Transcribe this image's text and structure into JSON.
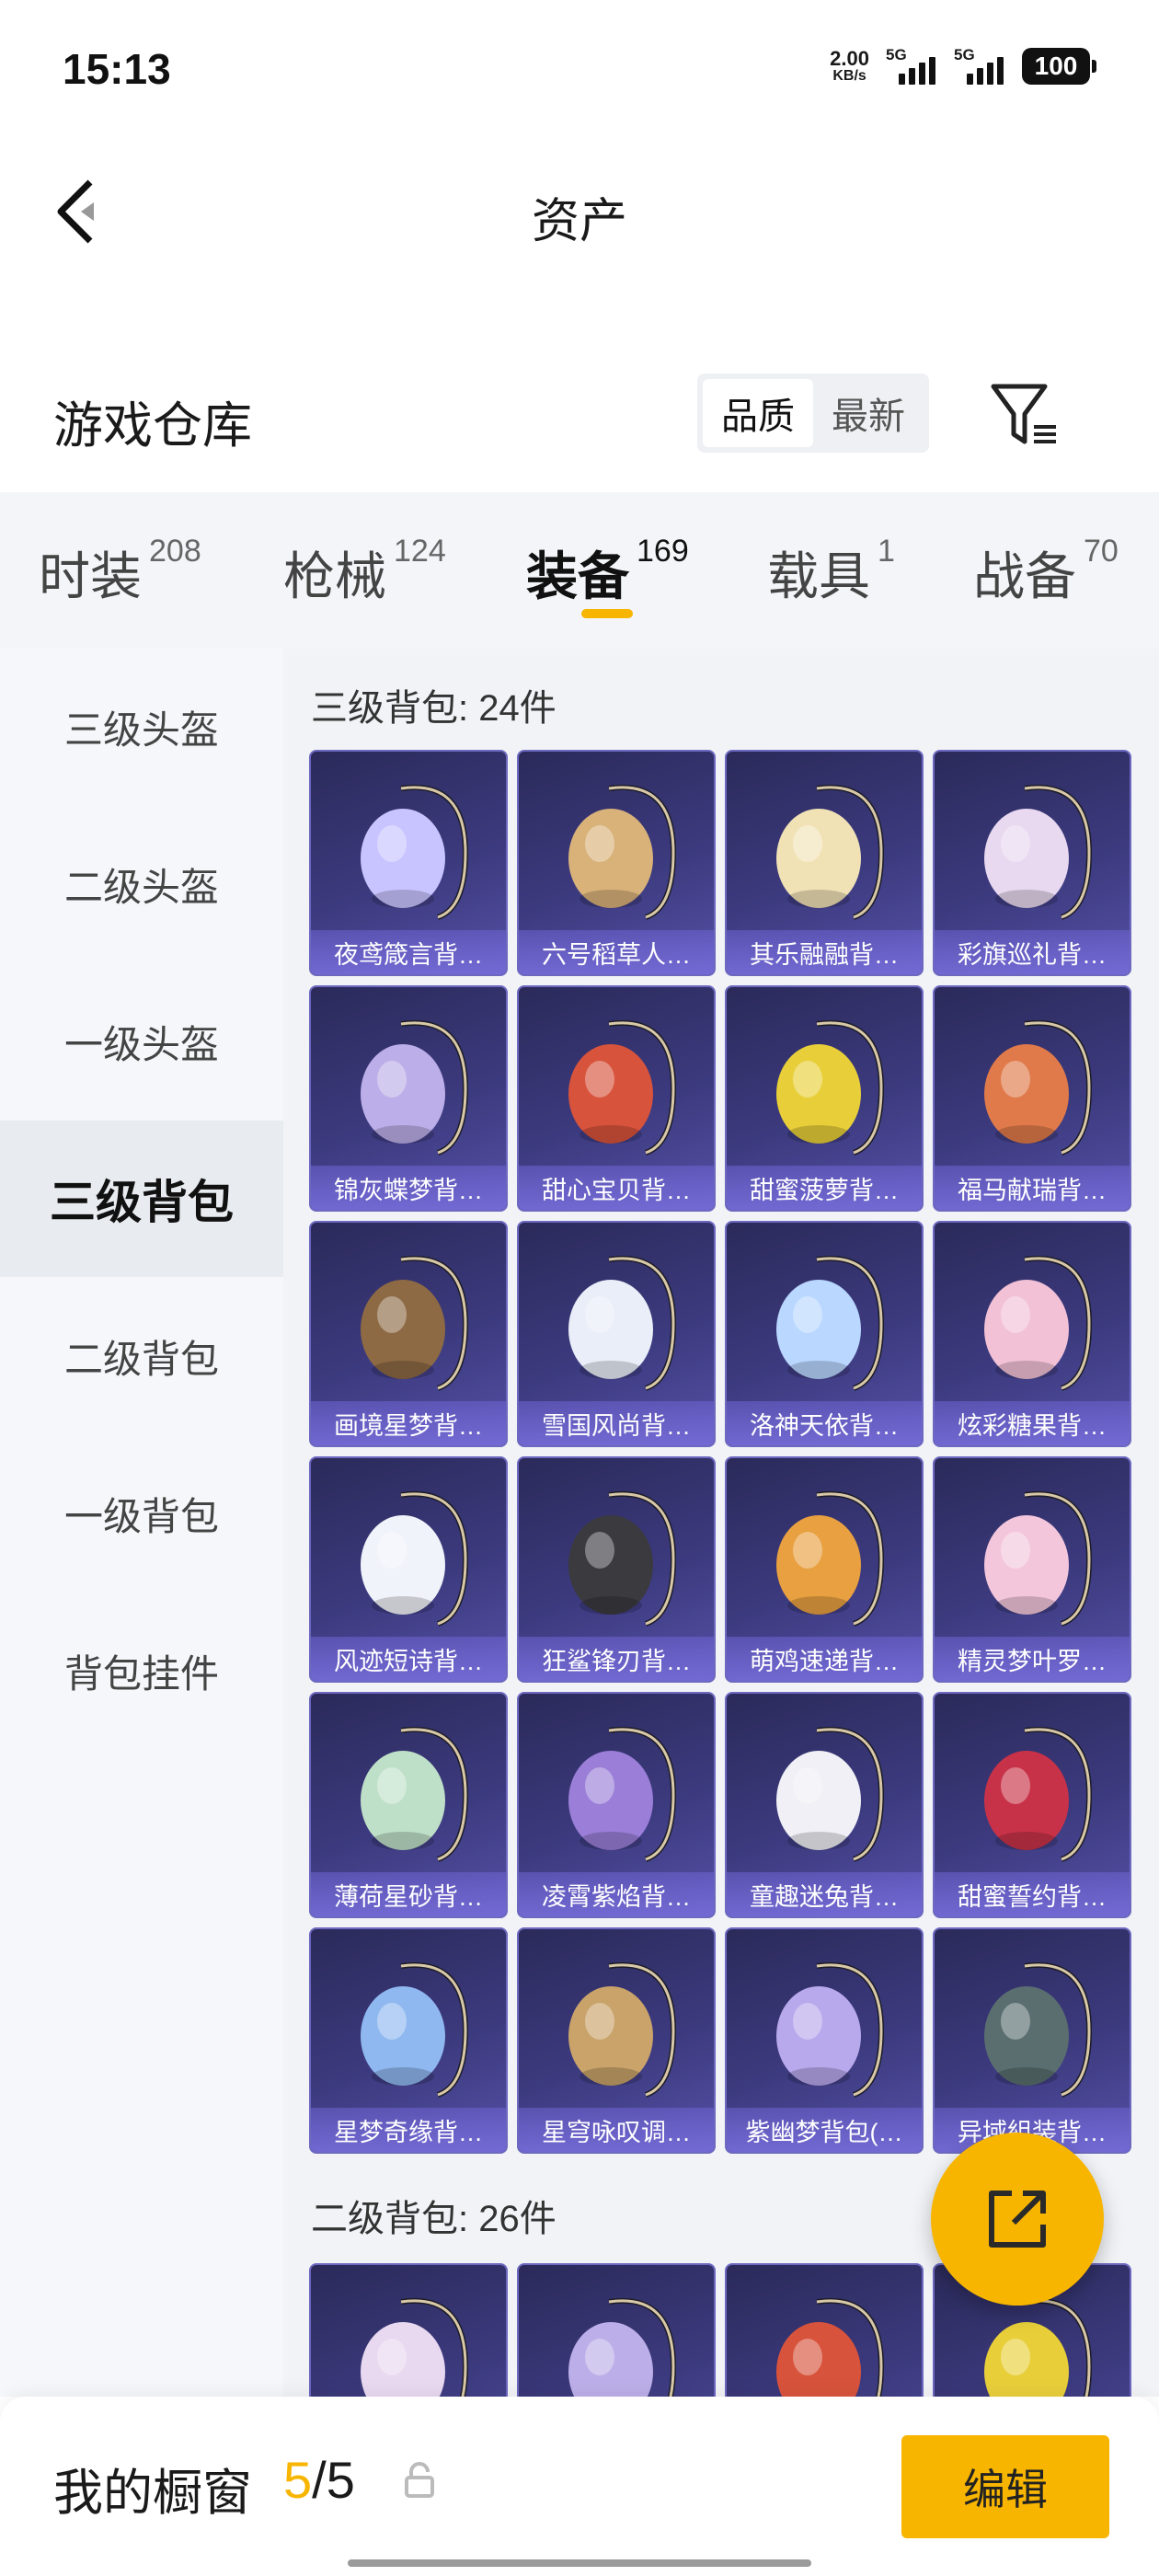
{
  "status_bar": {
    "time": "15:13",
    "net_speed_value": "2.00",
    "net_speed_unit": "KB/s",
    "signal1_label": "5G",
    "signal2_label": "5G",
    "battery": "100"
  },
  "header": {
    "title": "资产",
    "back_icon": "chevron-left-icon"
  },
  "warehouse": {
    "title": "游戏仓库",
    "sort_options": [
      "品质",
      "最新"
    ],
    "sort_selected": "品质",
    "filter_icon": "filter-icon"
  },
  "tabs": [
    {
      "label": "时装",
      "count": "208",
      "active": false
    },
    {
      "label": "枪械",
      "count": "124",
      "active": false
    },
    {
      "label": "装备",
      "count": "169",
      "active": true
    },
    {
      "label": "载具",
      "count": "1",
      "active": false
    },
    {
      "label": "战备",
      "count": "70",
      "active": false
    }
  ],
  "side_nav": [
    {
      "label": "三级头盔",
      "active": false
    },
    {
      "label": "二级头盔",
      "active": false
    },
    {
      "label": "一级头盔",
      "active": false
    },
    {
      "label": "三级背包",
      "active": true
    },
    {
      "label": "二级背包",
      "active": false
    },
    {
      "label": "一级背包",
      "active": false
    },
    {
      "label": "背包挂件",
      "active": false
    }
  ],
  "sections": [
    {
      "title": "三级背包: 24件",
      "items": [
        "夜鸢箴言背…",
        "六号稻草人…",
        "其乐融融背…",
        "彩旗巡礼背…",
        "锦灰蝶梦背…",
        "甜心宝贝背…",
        "甜蜜菠萝背…",
        "福马献瑞背…",
        "画境星梦背…",
        "雪国风尚背…",
        "洛神天依背…",
        "炫彩糖果背…",
        "风迹短诗背…",
        "狂鲨锋刃背…",
        "萌鸡速递背…",
        "精灵梦叶罗…",
        "薄荷星砂背…",
        "凌霄紫焰背…",
        "童趣迷兔背…",
        "甜蜜誓约背…",
        "星梦奇缘背…",
        "星穹咏叹调…",
        "紫幽梦背包(…",
        "异域組装背…"
      ]
    },
    {
      "title": "二级背包: 26件",
      "items": [
        "",
        "",
        "",
        ""
      ]
    }
  ],
  "bottom_bar": {
    "showcase_label": "我的橱窗",
    "current": "5",
    "separator": "/",
    "total": "5",
    "edit_label": "编辑"
  },
  "colors": {
    "accent": "#f7b500",
    "card_bg": "#3c3a7e"
  }
}
